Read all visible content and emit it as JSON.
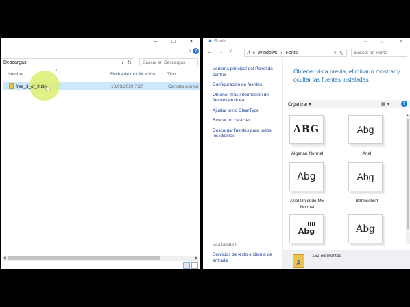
{
  "explorer": {
    "address": "Descargas",
    "search_placeholder": "Buscar en Descargas",
    "columns": [
      "Nombre",
      "Fecha de modificación",
      "Tipo"
    ],
    "file": {
      "name": "free_3_of_9.zip",
      "modified": "18/03/2020 7:27",
      "type": "Carpeta compri"
    },
    "help_glyph": "?"
  },
  "fonts_window": {
    "title": "Fonts",
    "breadcrumb": [
      "Windows",
      "Fonts"
    ],
    "search_placeholder": "Buscar en Fonts",
    "sidebar_links": [
      "Ventana principal del Panel de control",
      "Configuración de fuentes",
      "Obtener más información de fuentes en línea",
      "Ajustar texto ClearType",
      "Buscar un carácter",
      "Descargar fuentes para todos los idiomas"
    ],
    "see_also": "Vea también",
    "see_also_link": "Servicios de texto e idioma de entrada",
    "main_title": "Obtener vista previa, eliminar o mostrar y ocultar las fuentes instaladas",
    "organize": "Organizar",
    "fonts": [
      {
        "name": "Algerian Normal",
        "sample": "ABG"
      },
      {
        "name": "Arial",
        "sample": "Abg"
      },
      {
        "name": "Arial Unicode MS Normal",
        "sample": "Abg"
      },
      {
        "name": "Bahnschrift",
        "sample": "Abg"
      },
      {
        "name": "",
        "sample": "Abg"
      },
      {
        "name": "",
        "sample": "Abg"
      }
    ],
    "status": "152 elementos"
  }
}
